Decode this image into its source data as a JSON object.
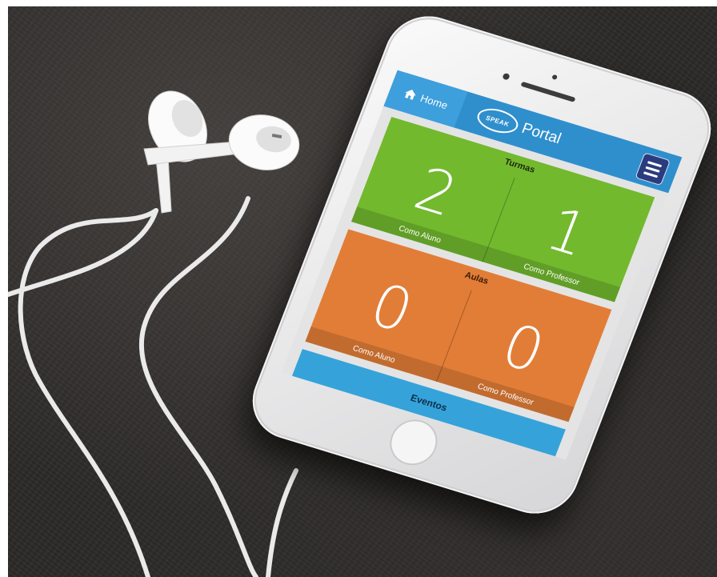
{
  "app": {
    "home_label": "Home",
    "logo_text": "SPEAK",
    "portal_label": "Portal"
  },
  "icons": {
    "home": "home-icon",
    "menu": "hamburger-menu-icon"
  },
  "colors": {
    "topbar": "#2f8fcd",
    "menu_button": "#2b3b7e",
    "turmas_card": "#72b92e",
    "aulas_card": "#e27d37",
    "eventos_bar": "#35a3da"
  },
  "cards": [
    {
      "title": "Turmas",
      "left": {
        "value": "2",
        "label": "Como Aluno"
      },
      "right": {
        "value": "1",
        "label": "Como Professor"
      }
    },
    {
      "title": "Aulas",
      "left": {
        "value": "0",
        "label": "Como Aluno"
      },
      "right": {
        "value": "0",
        "label": "Como Professor"
      }
    }
  ],
  "events": {
    "label": "Eventos"
  }
}
